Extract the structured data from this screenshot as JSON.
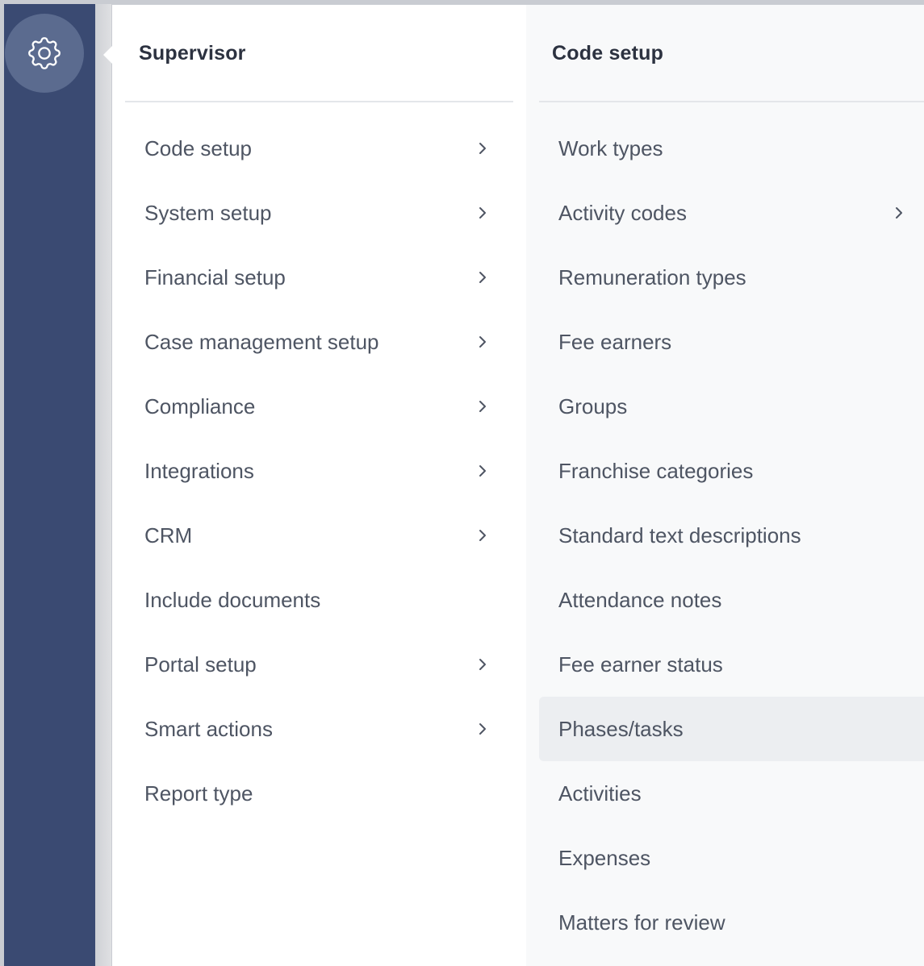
{
  "sidebar": {
    "settings_icon": "gear-icon"
  },
  "supervisor_menu": {
    "title": "Supervisor",
    "items": [
      {
        "label": "Code setup",
        "has_submenu": true
      },
      {
        "label": "System setup",
        "has_submenu": true
      },
      {
        "label": "Financial setup",
        "has_submenu": true
      },
      {
        "label": "Case management setup",
        "has_submenu": true
      },
      {
        "label": "Compliance",
        "has_submenu": true
      },
      {
        "label": "Integrations",
        "has_submenu": true
      },
      {
        "label": "CRM",
        "has_submenu": true
      },
      {
        "label": "Include documents",
        "has_submenu": false
      },
      {
        "label": "Portal setup",
        "has_submenu": true
      },
      {
        "label": "Smart actions",
        "has_submenu": true
      },
      {
        "label": "Report type",
        "has_submenu": false
      }
    ]
  },
  "code_setup_menu": {
    "title": "Code setup",
    "items": [
      {
        "label": "Work types",
        "has_submenu": false
      },
      {
        "label": "Activity codes",
        "has_submenu": true
      },
      {
        "label": "Remuneration types",
        "has_submenu": false
      },
      {
        "label": "Fee earners",
        "has_submenu": false
      },
      {
        "label": "Groups",
        "has_submenu": false
      },
      {
        "label": "Franchise categories",
        "has_submenu": false
      },
      {
        "label": "Standard text descriptions",
        "has_submenu": false
      },
      {
        "label": "Attendance notes",
        "has_submenu": false
      },
      {
        "label": "Fee earner status",
        "has_submenu": false
      },
      {
        "label": "Phases/tasks",
        "has_submenu": false,
        "hovered": true
      },
      {
        "label": "Activities",
        "has_submenu": false
      },
      {
        "label": "Expenses",
        "has_submenu": false
      },
      {
        "label": "Matters for review",
        "has_submenu": false
      }
    ]
  },
  "colors": {
    "sidebar_bg": "#3a4a72",
    "gear_button_bg": "#5b6b8f",
    "hover_bg": "#eceef1",
    "text": "#4e5563",
    "title_text": "#2c3240"
  }
}
